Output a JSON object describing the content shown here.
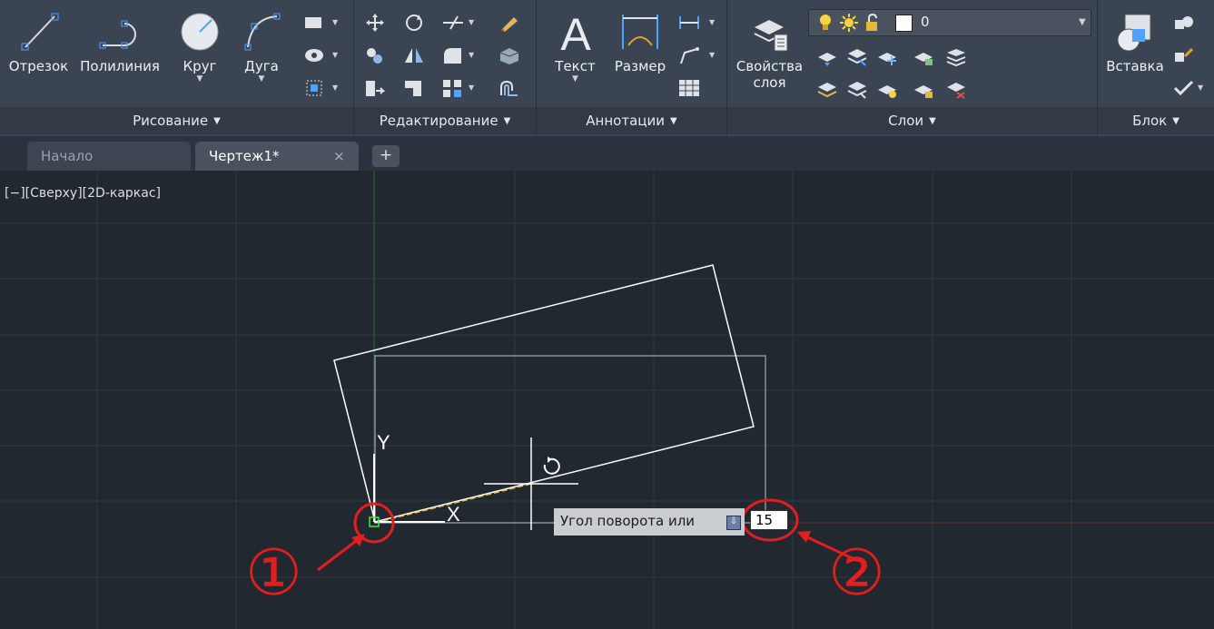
{
  "ribbon": {
    "draw": {
      "title": "Рисование",
      "buttons": {
        "line": "Отрезок",
        "polyline": "Полилиния",
        "circle": "Круг",
        "arc": "Дуга"
      }
    },
    "modify": {
      "title": "Редактирование"
    },
    "annotation": {
      "title": "Аннотации",
      "buttons": {
        "text": "Текст",
        "dimension": "Размер"
      }
    },
    "layers": {
      "title": "Слои",
      "properties_line1": "Свойства",
      "properties_line2": "слоя",
      "current_layer": "0"
    },
    "block": {
      "title": "Блок",
      "insert": "Вставка"
    }
  },
  "tabs": {
    "home": "Начало",
    "drawing": "Чертеж1*",
    "close": "×",
    "add": "+"
  },
  "viewport": {
    "label": "[−][Сверху][2D-каркас]"
  },
  "ucs": {
    "y_label": "Y",
    "x_label": "X"
  },
  "prompt": {
    "text": "Угол поворота или",
    "value": "15"
  },
  "callouts": {
    "one": "①",
    "two": "②"
  },
  "colors": {
    "ribbon": "#3b4453",
    "canvas": "#212830",
    "callout": "#e31e1e"
  }
}
